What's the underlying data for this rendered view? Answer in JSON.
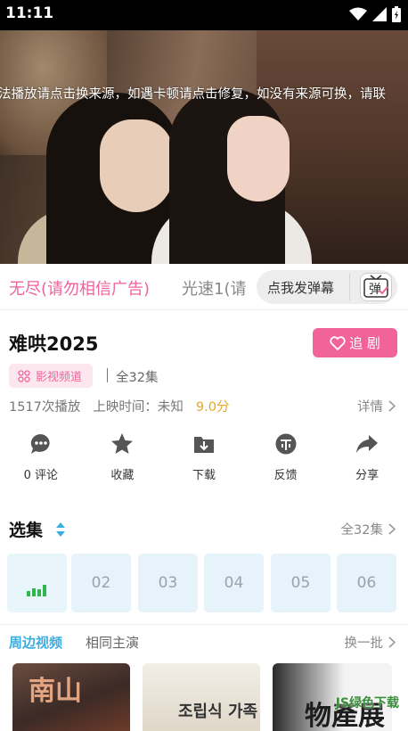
{
  "status_bar": {
    "time": "11:11"
  },
  "video": {
    "notice": "法播放请点击换来源，如遇卡顿请点击修复，如没有来源可换，请联"
  },
  "sources": {
    "active": "无尽(请勿相信广告)",
    "other": "光速1(请",
    "danmu_label": "点我发弹幕",
    "danmu_button": "弹"
  },
  "show": {
    "title": "难哄2025",
    "follow_label": "追 剧",
    "channel_tag": "影视频道",
    "episodes_total": "全32集",
    "plays": "1517次播放",
    "release": "上映时间：未知",
    "score": "9.0分",
    "details": "详情"
  },
  "actions": [
    {
      "label": "0 评论",
      "icon": "comment-icon"
    },
    {
      "label": "收藏",
      "icon": "star-icon"
    },
    {
      "label": "下载",
      "icon": "download-icon"
    },
    {
      "label": "反馈",
      "icon": "feedback-icon"
    },
    {
      "label": "分享",
      "icon": "share-icon"
    }
  ],
  "episodes": {
    "title": "选集",
    "all": "全32集",
    "items": [
      "02",
      "03",
      "04",
      "05",
      "06"
    ],
    "accent": "#2eb84b"
  },
  "recommend": {
    "tab_active": "周边视频",
    "tab_other": "相同主演",
    "refresh": "换一批",
    "thumbs": [
      "南山",
      "조립식 가족",
      "物產展"
    ]
  },
  "watermark": "JS绿色下载",
  "colors": {
    "pink": "#f0639b",
    "blue": "#3aaee0",
    "score": "#e3a72a"
  }
}
